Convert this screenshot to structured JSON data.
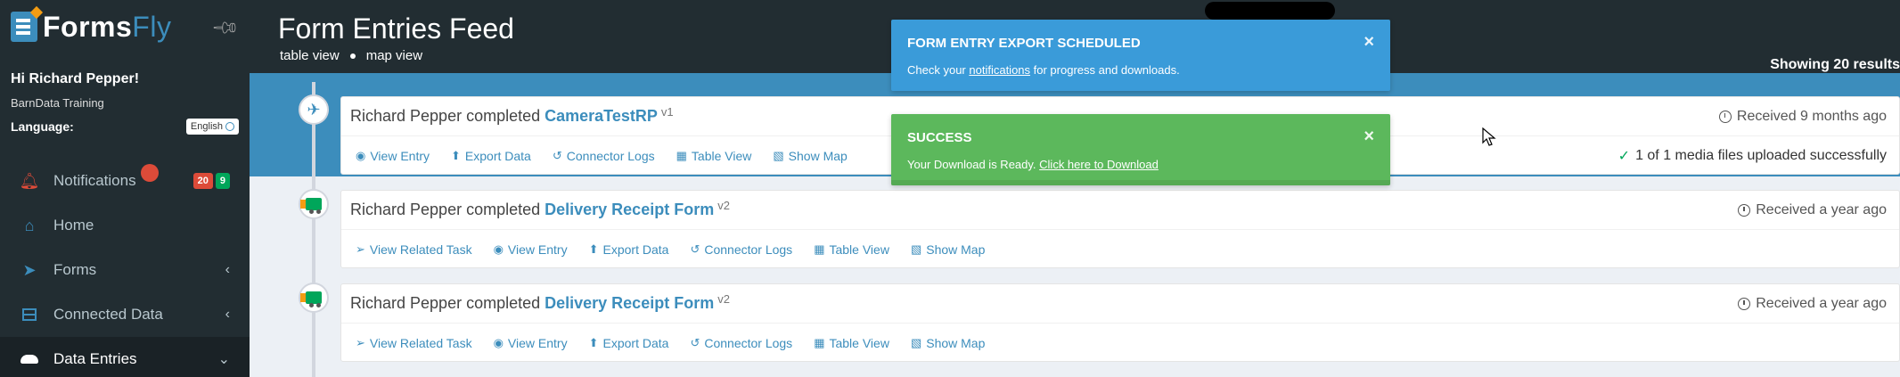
{
  "app": {
    "name_part1": "Forms",
    "name_part2": "Fly"
  },
  "user": {
    "greeting": "Hi Richard Pepper!",
    "org": "BarnData Training",
    "language_label": "Language:",
    "language_value": "English"
  },
  "menu": {
    "notifications": {
      "label": "Notifications",
      "badge_red": "20",
      "badge_green": "9"
    },
    "home": "Home",
    "forms": "Forms",
    "connected_data": "Connected Data",
    "data_entries": "Data Entries"
  },
  "header": {
    "title": "Form Entries Feed",
    "table_view": "table view",
    "map_view": "map view",
    "showing": "Showing 20 results"
  },
  "toasts": {
    "export": {
      "title": "FORM ENTRY EXPORT SCHEDULED",
      "body_before": "Check your ",
      "link": "notifications",
      "body_after": " for progress and downloads.",
      "close": "×"
    },
    "success": {
      "title": "SUCCESS",
      "body_before": "Your Download is Ready. ",
      "link": "Click here to Download",
      "close": "×"
    }
  },
  "entries": [
    {
      "user": "Richard Pepper completed",
      "form": "CameraTestRP",
      "version": "v1",
      "received": "Received 9 months ago",
      "media": "1 of 1 media files uploaded successfully",
      "actions": [
        "View Entry",
        "Export Data",
        "Connector Logs",
        "Table View",
        "Show Map"
      ]
    },
    {
      "user": "Richard Pepper completed",
      "form": "Delivery Receipt Form",
      "version": "v2",
      "received": "Received a year ago",
      "actions": [
        "View Related Task",
        "View Entry",
        "Export Data",
        "Connector Logs",
        "Table View",
        "Show Map"
      ]
    },
    {
      "user": "Richard Pepper completed",
      "form": "Delivery Receipt Form",
      "version": "v2",
      "received": "Received a year ago",
      "actions": [
        "View Related Task",
        "View Entry",
        "Export Data",
        "Connector Logs",
        "Table View",
        "Show Map"
      ]
    }
  ],
  "colors": {
    "sidebar": "#222d32",
    "accent": "#3c8dbc",
    "success": "#5cb85c",
    "info": "#3a9bd9",
    "danger": "#dd4b39"
  }
}
